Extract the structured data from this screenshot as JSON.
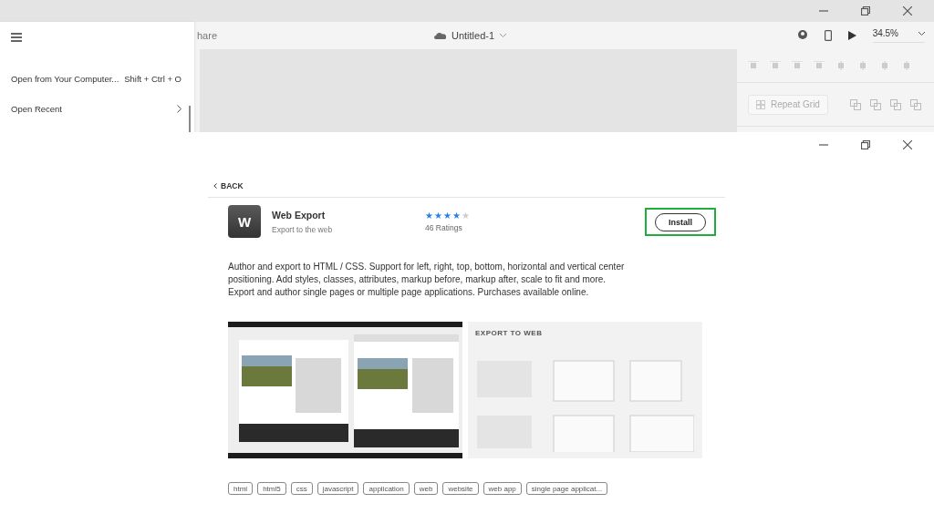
{
  "app": {
    "share_label": "hare",
    "document_title": "Untitled-1",
    "zoom": "34.5%",
    "repeat_grid": "Repeat Grid"
  },
  "menu": {
    "items": [
      {
        "kind": "shortcut",
        "label": "Open from Your Computer...",
        "shortcut": "Shift + Ctrl + O"
      },
      {
        "kind": "submenu",
        "label": "Open Recent"
      }
    ]
  },
  "plugin": {
    "back": "BACK",
    "icon_letter": "W",
    "name": "Web Export",
    "tagline": "Export to the web",
    "stars": 4,
    "ratings": "46 Ratings",
    "install": "Install",
    "install_highlighted": true,
    "description": "Author and export to HTML / CSS. Support for left, right, top, bottom, horizontal and vertical center positioning. Add styles, classes, attributes, markup before, markup after, scale to fit and more. Export and author single pages or multiple page applications. Purchases available online.",
    "previews": [
      {
        "kind": "picture"
      },
      {
        "kind": "promo",
        "heading": "EXPORT TO WEB"
      }
    ],
    "tags": [
      "html",
      "html5",
      "css",
      "javascript",
      "application",
      "web",
      "website",
      "web app",
      "single page applicat..."
    ]
  }
}
